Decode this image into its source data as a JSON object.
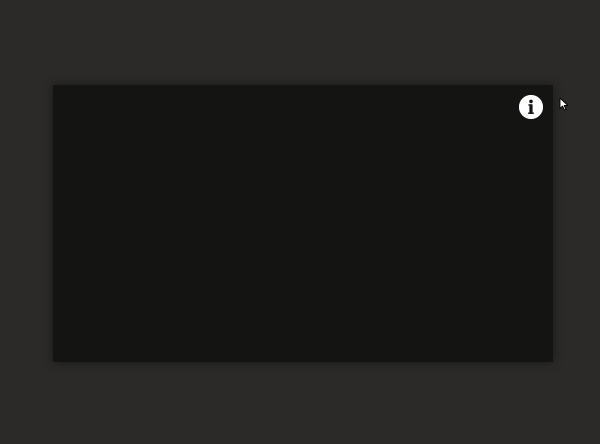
{
  "page": {
    "background_color": "#2b2a29"
  },
  "viewer": {
    "background_color": "#141413",
    "info_button": {
      "icon": "info-icon",
      "color": "#ffffff"
    }
  },
  "cursor": {
    "icon": "mouse-pointer-icon"
  }
}
